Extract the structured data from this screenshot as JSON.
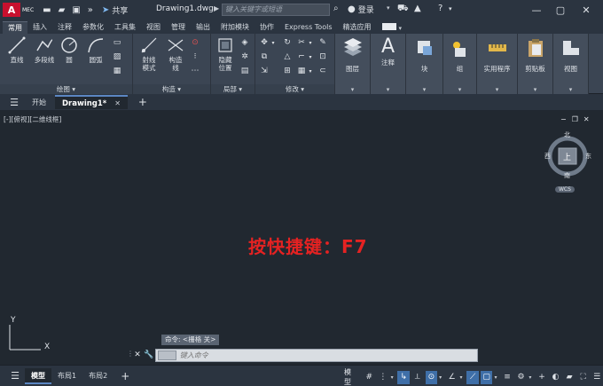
{
  "app": {
    "logo_text": "A",
    "logo_sub": "MEC",
    "share_label": "共享",
    "document_title": "Drawing1.dwg",
    "search_placeholder": "键入关键字或短语",
    "login_label": "登录"
  },
  "ribbon_tabs": [
    "常用",
    "插入",
    "注释",
    "参数化",
    "工具集",
    "视图",
    "管理",
    "输出",
    "附加模块",
    "协作",
    "Express Tools",
    "精选应用"
  ],
  "ribbon": {
    "draw": {
      "footer": "绘图",
      "line": "直线",
      "polyline": "多段线",
      "circle": "圆",
      "arc": "圆弧"
    },
    "construct": {
      "footer": "构造",
      "ray": "射线\n模式",
      "xline": "构造\n线"
    },
    "layers": {
      "footer": "局部",
      "hide": "隐藏\n位置"
    },
    "modify": {
      "footer": "修改"
    },
    "big": {
      "layers": "图层",
      "annotation": "注释",
      "block": "块",
      "group": "组",
      "utilities": "实用程序",
      "clipboard": "剪贴板",
      "view": "视图"
    }
  },
  "file_tabs": {
    "start": "开始",
    "active": "Drawing1*"
  },
  "canvas": {
    "view_label": "[-][俯视][二维线框]",
    "overlay_text": "按快捷键：F7",
    "viewcube": {
      "north": "北",
      "south": "南",
      "east": "东",
      "west": "西",
      "top": "上",
      "wcs": "WCS"
    },
    "ucs_x": "X",
    "ucs_y": "Y"
  },
  "command": {
    "history": "命令: <栅格 关>",
    "placeholder": "键入命令"
  },
  "status": {
    "layout_tabs": [
      "模型",
      "布局1",
      "布局2"
    ],
    "model_label": "模型"
  }
}
